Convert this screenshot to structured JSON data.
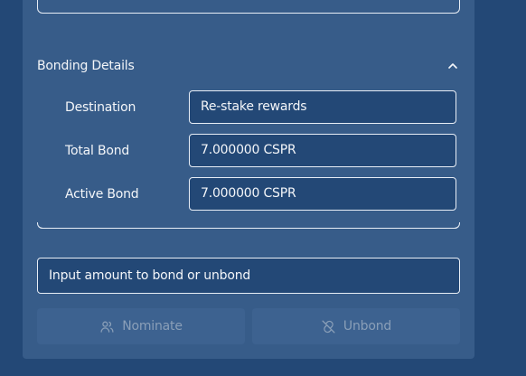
{
  "bonding": {
    "section_title": "Bonding Details",
    "rows": [
      {
        "label": "Destination",
        "value": "Re-stake rewards"
      },
      {
        "label": "Total Bond",
        "value": "7.000000 CSPR"
      },
      {
        "label": "Active Bond",
        "value": "7.000000 CSPR"
      }
    ]
  },
  "amount_input": {
    "placeholder": "Input amount to bond or unbond",
    "value": ""
  },
  "actions": {
    "nominate_label": "Nominate",
    "nominate_icon": "users-icon",
    "unbond_label": "Unbond",
    "unbond_icon": "unlink-icon"
  },
  "colors": {
    "page_background": "#234876",
    "panel_background": "#375c89",
    "field_background": "#234876",
    "border": "#e8eef6",
    "text": "#f4f6f9",
    "disabled_text": "#8a9fb8",
    "disabled_button": "#3d6290"
  }
}
